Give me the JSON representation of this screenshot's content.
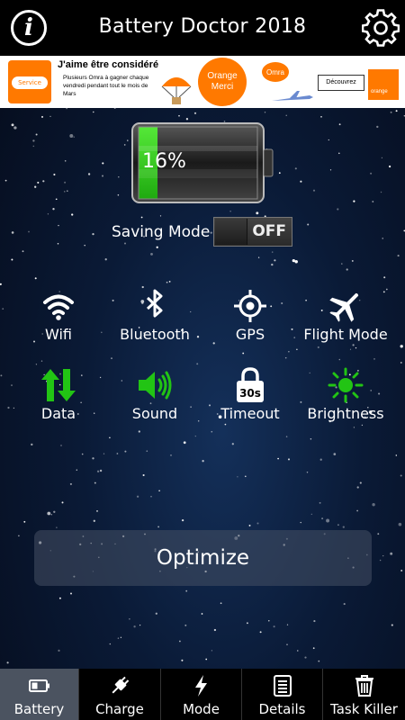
{
  "header": {
    "title": "Battery Doctor 2018",
    "info_icon": "info-icon",
    "settings_icon": "gear-icon"
  },
  "ad": {
    "service_label": "Service",
    "headline": "J'aime être considéré",
    "body": "Plusieurs Omra à gagner chaque vendredi pendant tout le mois de Mars",
    "circle_text": "Orange Merci",
    "balloon_label": "Omra",
    "cta": "Découvrez",
    "logo_text": "orange",
    "accent": "#ff7900"
  },
  "battery": {
    "percent_label": "16%",
    "level": 0.16,
    "fill_color": "#2ecc1f"
  },
  "saving_mode": {
    "label": "Saving Mode",
    "state": "OFF"
  },
  "features": [
    {
      "label": "Wifi",
      "icon": "wifi-icon",
      "color": "#ffffff"
    },
    {
      "label": "Bluetooth",
      "icon": "bluetooth-icon",
      "color": "#ffffff"
    },
    {
      "label": "GPS",
      "icon": "gps-icon",
      "color": "#ffffff"
    },
    {
      "label": "Flight Mode",
      "icon": "airplane-icon",
      "color": "#ffffff"
    },
    {
      "label": "Data",
      "icon": "data-arrows-icon",
      "color": "#22c414"
    },
    {
      "label": "Sound",
      "icon": "speaker-icon",
      "color": "#22c414"
    },
    {
      "label": "Timeout",
      "icon": "timeout-lock-icon",
      "timeout_value": "30s",
      "color": "#ffffff"
    },
    {
      "label": "Brightness",
      "icon": "sun-icon",
      "color": "#22c414"
    }
  ],
  "optimize_label": "Optimize",
  "nav": [
    {
      "label": "Battery",
      "icon": "battery-icon",
      "active": true
    },
    {
      "label": "Charge",
      "icon": "plug-icon",
      "active": false
    },
    {
      "label": "Mode",
      "icon": "lightning-icon",
      "active": false
    },
    {
      "label": "Details",
      "icon": "list-icon",
      "active": false
    },
    {
      "label": "Task Killer",
      "icon": "trash-icon",
      "active": false
    }
  ]
}
